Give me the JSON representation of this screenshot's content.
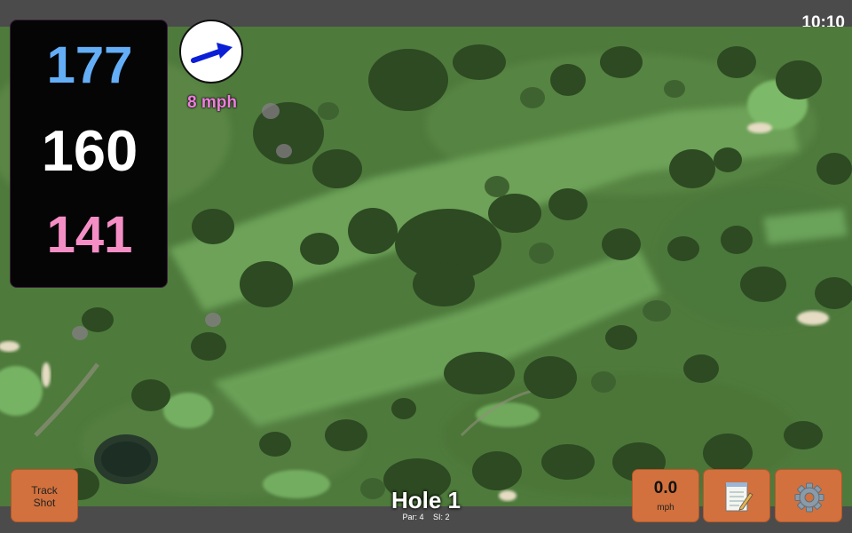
{
  "status_bar": {
    "time": "10:10"
  },
  "yardages": {
    "back": "177",
    "middle": "160",
    "front": "141"
  },
  "wind": {
    "speed_label": "8 mph",
    "direction": "east-northeast"
  },
  "buttons": {
    "track_shot_line1": "Track",
    "track_shot_line2": "Shot",
    "speed_value": "0.0",
    "speed_unit": "mph",
    "notes_icon": "notepad-icon",
    "settings_icon": "gear-icon"
  },
  "hole": {
    "title": "Hole 1",
    "par": "Par: 4",
    "si": "SI: 2"
  },
  "colors": {
    "back_yardage": "#64aef7",
    "middle_yardage": "#ffffff",
    "front_yardage": "#f68ec6",
    "wind_text": "#f07de0",
    "button": "#d2713d",
    "wind_arrow": "#0a1fd6"
  }
}
